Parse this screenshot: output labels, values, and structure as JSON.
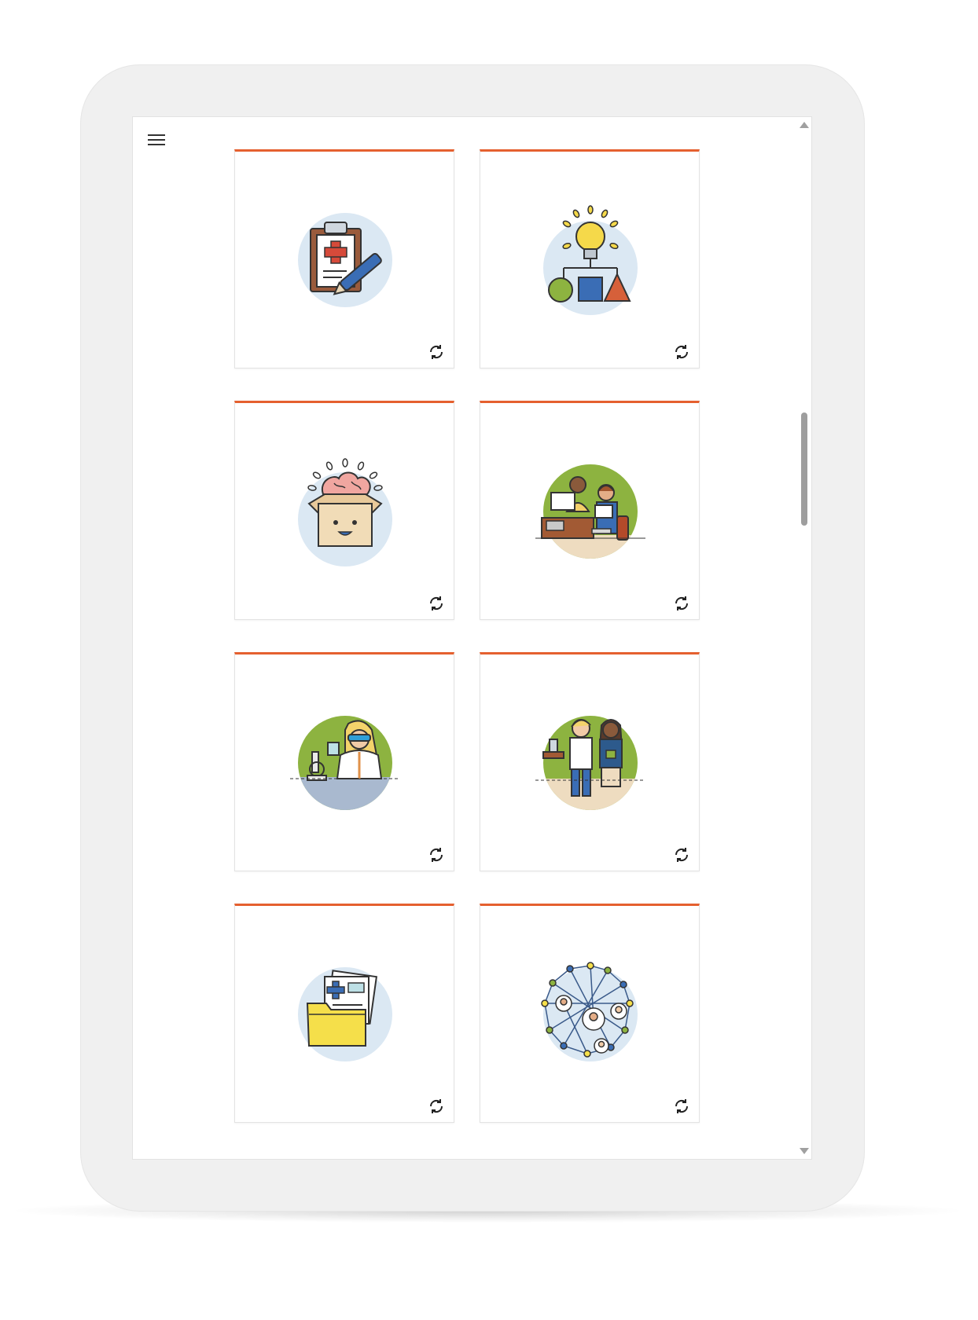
{
  "app": {
    "menu_icon": "hamburger-menu-icon",
    "accent_color": "#e5602f"
  },
  "cards": [
    {
      "illustration": "medical-clipboard-illustration",
      "action_icon": "refresh-icon"
    },
    {
      "illustration": "lightbulb-shapes-illustration",
      "action_icon": "refresh-icon"
    },
    {
      "illustration": "brain-in-box-illustration",
      "action_icon": "refresh-icon"
    },
    {
      "illustration": "office-workers-illustration",
      "action_icon": "refresh-icon"
    },
    {
      "illustration": "scientist-microscope-illustration",
      "action_icon": "refresh-icon"
    },
    {
      "illustration": "two-colleagues-illustration",
      "action_icon": "refresh-icon"
    },
    {
      "illustration": "medical-folder-illustration",
      "action_icon": "refresh-icon"
    },
    {
      "illustration": "people-network-illustration",
      "action_icon": "refresh-icon"
    }
  ]
}
